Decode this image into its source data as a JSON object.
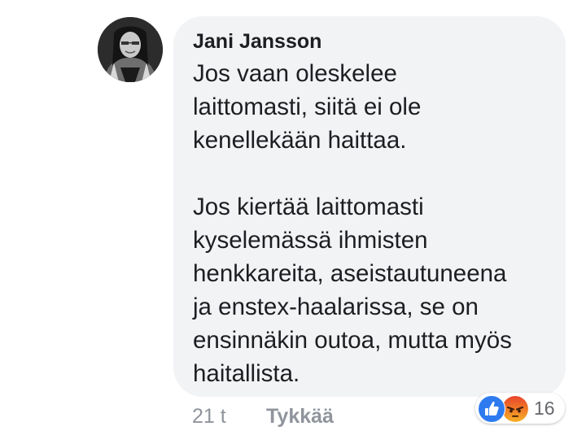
{
  "comment": {
    "author": "Jani Jansson",
    "paragraph1": [
      "Jos vaan oleskelee",
      "laittomasti, siitä ei ole",
      "kenellekään haittaa."
    ],
    "paragraph2": [
      "Jos kiertää laittomasti",
      "kyselemässä ihmisten",
      "henkkareita, aseistautuneena",
      "ja enstex-haalarissa, se on",
      "ensinnäkin outoa, mutta myös",
      "haitallista."
    ],
    "time": "21 t",
    "like_label": "Tykkää",
    "reactions": {
      "icons": [
        "like-icon",
        "angry-icon"
      ],
      "count": "16"
    }
  },
  "colors": {
    "bubble": "#f2f3f5",
    "text": "#1c1e21",
    "meta": "#90949c",
    "like_blue": "#2e7bf0",
    "angry_orange": "#e9710f"
  }
}
